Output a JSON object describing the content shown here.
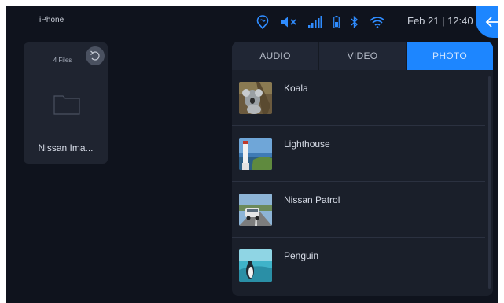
{
  "status_bar": {
    "device_name": "iPhone",
    "datetime": "Feb 21 | 12:40",
    "icons": [
      "voice-assistant-icon",
      "mute-icon",
      "signal-icon",
      "battery-icon",
      "bluetooth-icon",
      "wifi-icon",
      "back-arrow-icon"
    ],
    "accent_color": "#1d86ff"
  },
  "folder": {
    "file_count": "4 Files",
    "name": "Nissan Ima..."
  },
  "tabs": [
    {
      "label": "AUDIO",
      "active": false
    },
    {
      "label": "VIDEO",
      "active": false
    },
    {
      "label": "PHOTO",
      "active": true
    }
  ],
  "photos": [
    {
      "label": "Koala"
    },
    {
      "label": "Lighthouse"
    },
    {
      "label": "Nissan Patrol"
    },
    {
      "label": "Penguin"
    }
  ]
}
